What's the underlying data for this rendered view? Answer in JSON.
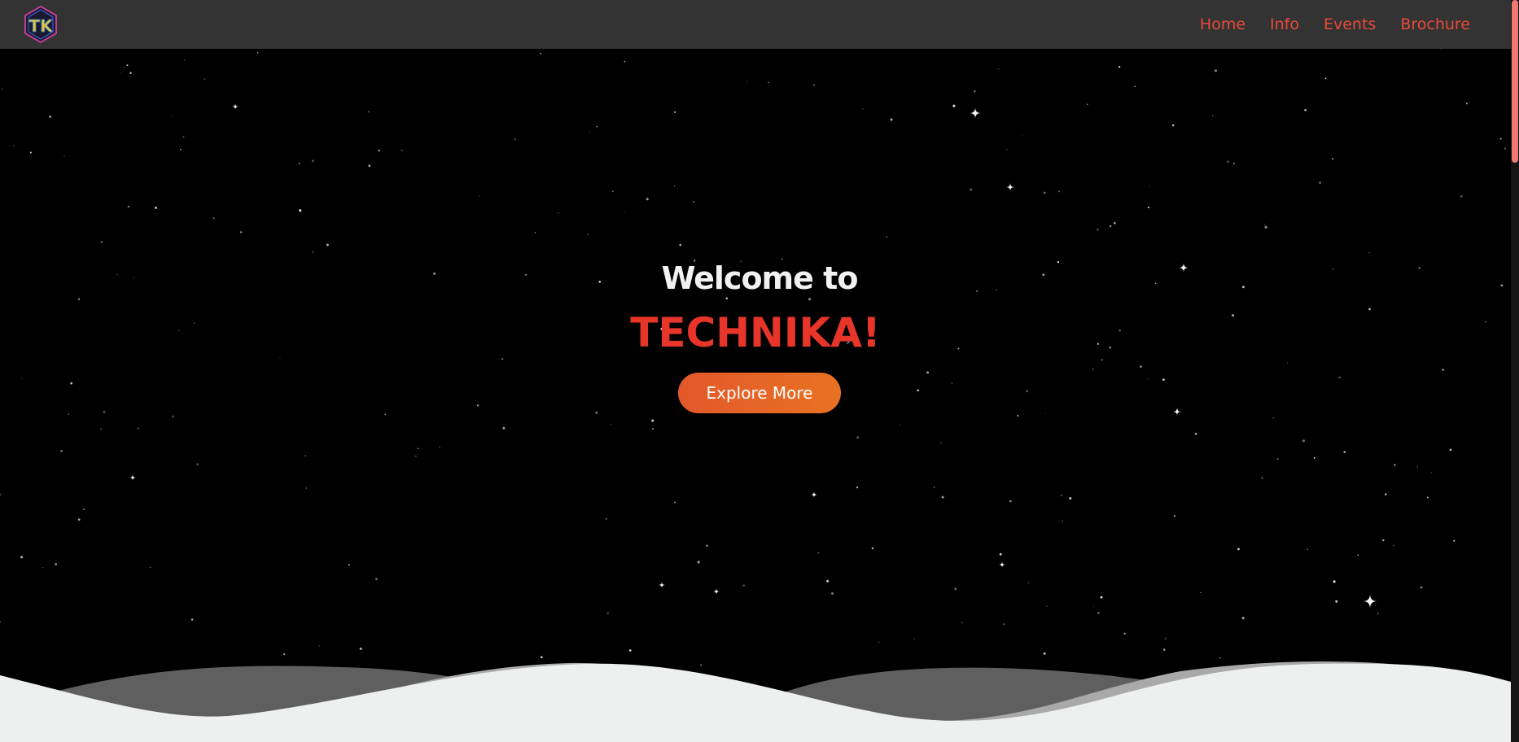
{
  "nav": {
    "logo_text": "TK",
    "links": [
      {
        "label": "Home"
      },
      {
        "label": "Info"
      },
      {
        "label": "Events"
      },
      {
        "label": "Brochure"
      }
    ]
  },
  "hero": {
    "welcome": "Welcome to",
    "title": "TECHNIKA!",
    "button_label": "Explore More"
  },
  "colors": {
    "navbar_bg": "#343434",
    "nav_link": "#e84a3a",
    "title": "#e8352a",
    "button_start": "#e2582a",
    "button_end": "#e87222",
    "wave_front": "#eef0ef",
    "wave_mid": "#a9a9a9",
    "wave_back": "#5f5f5f",
    "scroll_thumb": "#f07a72"
  },
  "icons": {
    "logo": "tk-hexagon-logo",
    "stars": "sparkle-star-icon"
  }
}
